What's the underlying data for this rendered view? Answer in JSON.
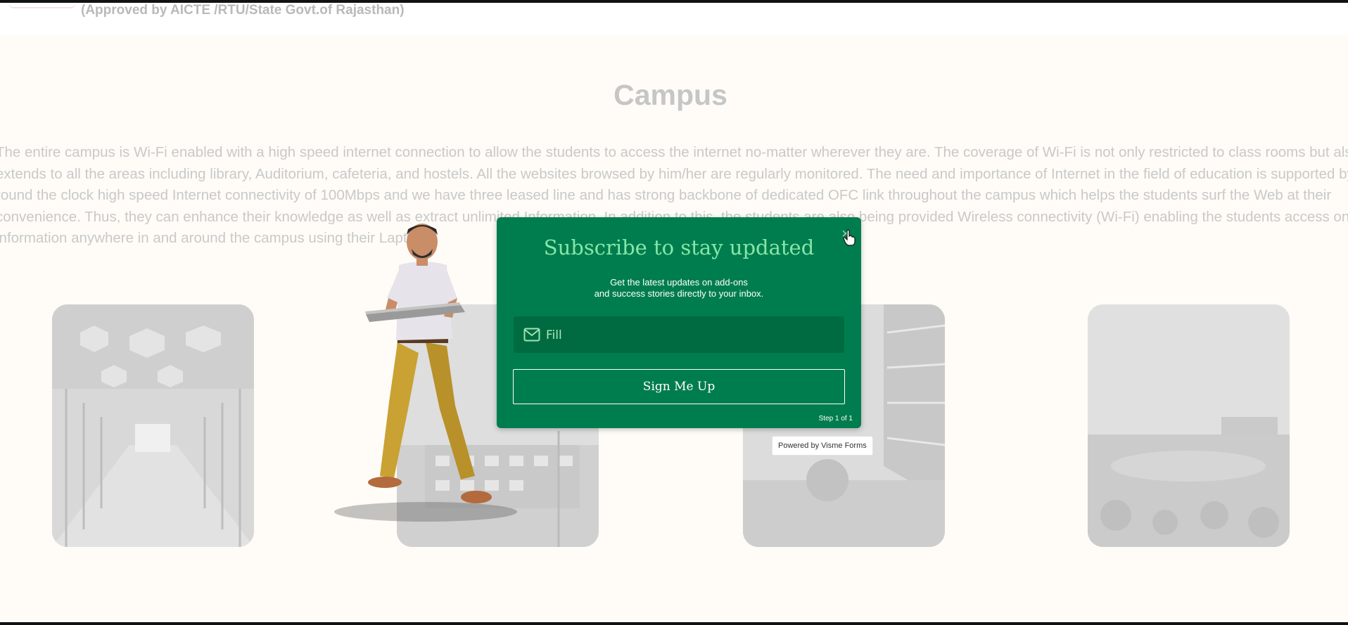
{
  "header": {
    "approved_text": "(Approved by AICTE /RTU/State Govt.of Rajasthan)"
  },
  "campus": {
    "title": "Campus",
    "paragraph_lines": [
      "The entire campus is Wi-Fi enabled with a high speed internet connection to allow the students to access the internet no-matter wherever they are. The coverage of Wi-Fi is not only restricted to class rooms but also",
      "extends to all the areas including library, Auditorium, cafeteria, and hostels. All the websites browsed by him/her are regularly monitored. The need and importance of Internet in the field of education is supported by",
      "round the clock high speed Internet connectivity of 100Mbps and we have three leased line and has strong backbone of dedicated OFC link throughout the campus which helps the students surf the Web at their",
      "convenience. Thus, they can enhance their knowledge as well as extract unlimited Information. In addition to this, the students are also being provided Wireless connectivity (Wi-Fi) enabling the students access online",
      "information anywhere in and around the campus using their Laptops."
    ]
  },
  "modal": {
    "title": "Subscribe to stay updated",
    "subtitle_line1": "Get the latest updates on add-ons",
    "subtitle_line2": "and success stories directly to your inbox.",
    "email_placeholder": "Fill",
    "email_value": "",
    "signup_label": "Sign Me Up",
    "step_text": "Step 1 of 1",
    "close_icon": "close-icon"
  },
  "powered_by": "Powered by Visme Forms",
  "colors": {
    "modal_bg": "#007d4e",
    "modal_title": "#86e6a7",
    "input_bg": "#006b40",
    "page_bg": "#fffcf7"
  }
}
